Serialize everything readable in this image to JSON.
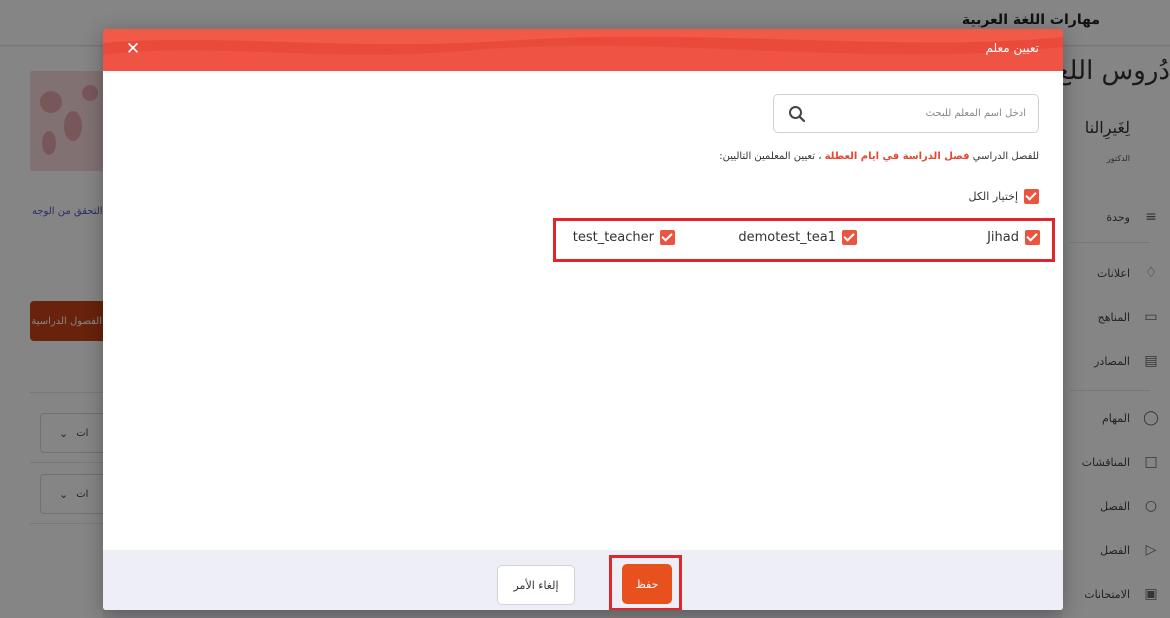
{
  "background": {
    "course_title": "مهارات اللغة العربية",
    "logo_line1": "دُروس اللغ",
    "logo_line2": "لِغَيرِالنا",
    "logo_small": "الدكتور",
    "left_link": "التحقق من الوجه",
    "left_button": "الفصول الدراسية",
    "dropdowns": [
      "ات",
      "ات"
    ],
    "menu": [
      "وحدة",
      "اعلانات",
      "المناهج",
      "المصادر",
      "المهام",
      "المناقشات",
      "الفصل",
      "الفصل",
      "الامتحانات"
    ]
  },
  "modal": {
    "title": "تعيين معلم",
    "close_icon": "close-icon",
    "search": {
      "placeholder": "أدخل اسم المعلم للبحث",
      "value": "",
      "icon": "search-icon"
    },
    "assign_prefix": "للفصل الدراسي",
    "course_name": "فصل الدراسة في ايام العطلة",
    "assign_suffix": "، تعيين المعلمين التاليين:",
    "select_all": {
      "label": "إختيار الكل",
      "checked": true
    },
    "teachers": [
      {
        "name": "Jihad",
        "checked": true
      },
      {
        "name": "demotest_tea1",
        "checked": true
      },
      {
        "name": "test_teacher",
        "checked": true
      }
    ],
    "footer": {
      "save_label": "حفظ",
      "cancel_label": "إلغاء الأمر"
    }
  },
  "colors": {
    "header": "#ee5343",
    "accent": "#e9553f",
    "save": "#e8501e",
    "highlight": "#e0262a"
  }
}
